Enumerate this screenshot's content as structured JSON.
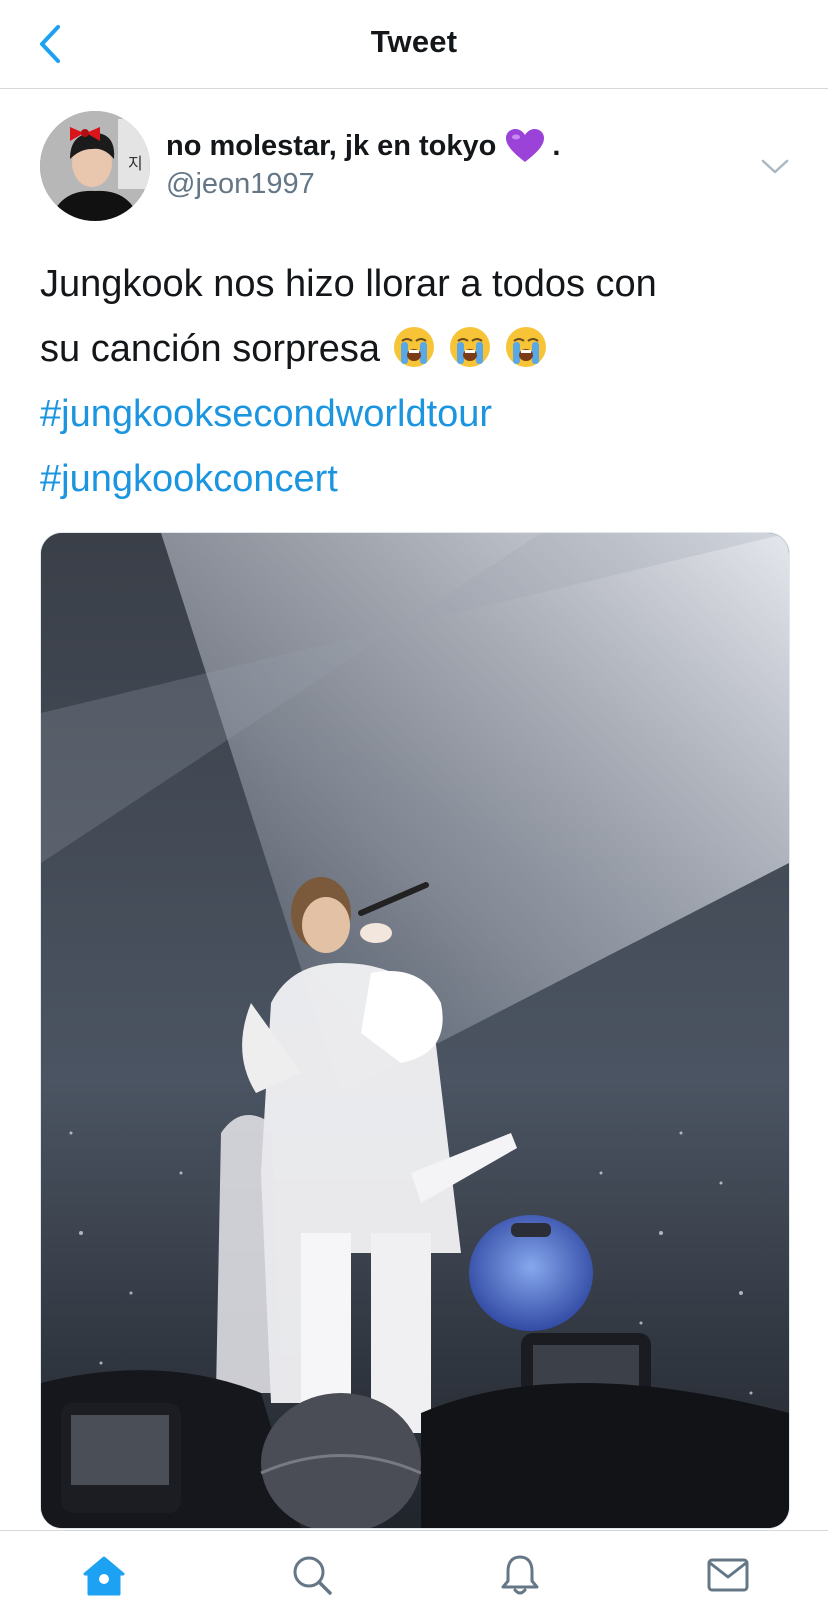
{
  "header": {
    "title": "Tweet",
    "back_icon": "chevron-left-icon"
  },
  "tweet": {
    "author": {
      "display_name": "no molestar, jk en tokyo",
      "name_suffix": ".",
      "name_emoji": "purple-heart-emoji",
      "handle": "@jeon1997",
      "avatar_text": "지"
    },
    "text_lines": [
      "Jungkook nos hizo llorar a todos con",
      "su canción sorpresa"
    ],
    "emojis": [
      "loudly-crying-face",
      "loudly-crying-face",
      "loudly-crying-face"
    ],
    "hashtags": [
      "#jungkooksecondworldtour",
      "#jungkookconcert"
    ],
    "media_description_icon": "concert-photo"
  },
  "colors": {
    "link": "#1b95e0",
    "secondary_text": "#657786",
    "divider": "#d5d9dc",
    "accent": "#1da1f2"
  },
  "tabbar": {
    "items": [
      {
        "icon": "home-icon",
        "active": true
      },
      {
        "icon": "search-icon",
        "active": false
      },
      {
        "icon": "notifications-bell-icon",
        "active": false
      },
      {
        "icon": "messages-envelope-icon",
        "active": false
      }
    ]
  }
}
